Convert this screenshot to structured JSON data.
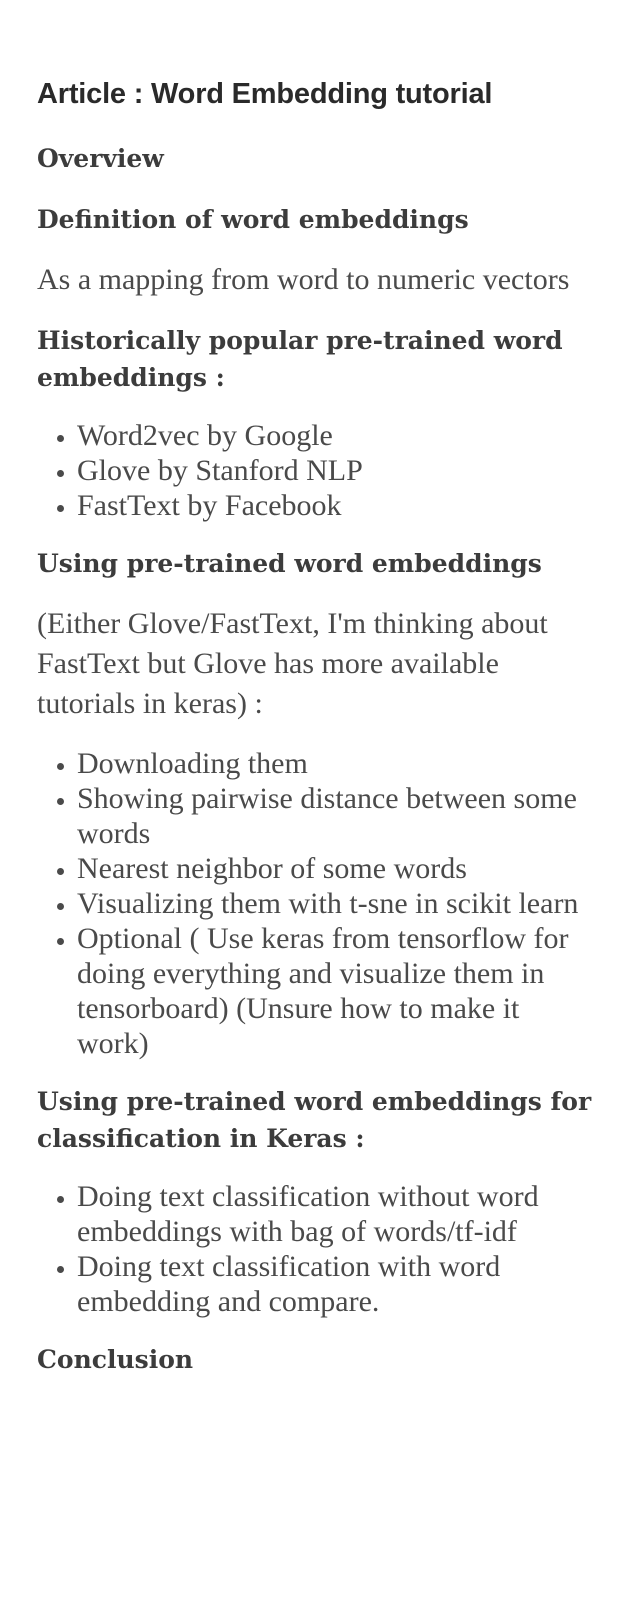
{
  "article": {
    "title": "Article : Word Embedding tutorial",
    "sections": [
      {
        "heading": "Overview"
      },
      {
        "heading": "Definition of word embeddings",
        "paragraph": "As a mapping from word to numeric vectors"
      },
      {
        "heading": "Historically popular pre-trained word embeddings :",
        "items": [
          "Word2vec by Google",
          "Glove by Stanford NLP",
          "FastText by Facebook"
        ]
      },
      {
        "heading": "Using pre-trained word embeddings",
        "paragraph": "(Either Glove/FastText, I'm thinking about FastText but Glove has more available tutorials in keras) :",
        "items": [
          "Downloading them",
          "Showing pairwise distance between some words",
          "Nearest neighbor of some words",
          "Visualizing them with t-sne in scikit learn",
          "Optional ( Use keras from tensorflow for doing everything and visualize them in tensorboard) (Unsure how to make it work)"
        ]
      },
      {
        "heading": "Using pre-trained word embeddings for classification in Keras :",
        "items": [
          "Doing text classification without word embeddings with bag of words/tf-idf",
          "Doing text classification with word embedding and compare."
        ]
      },
      {
        "heading": "Conclusion"
      }
    ]
  }
}
